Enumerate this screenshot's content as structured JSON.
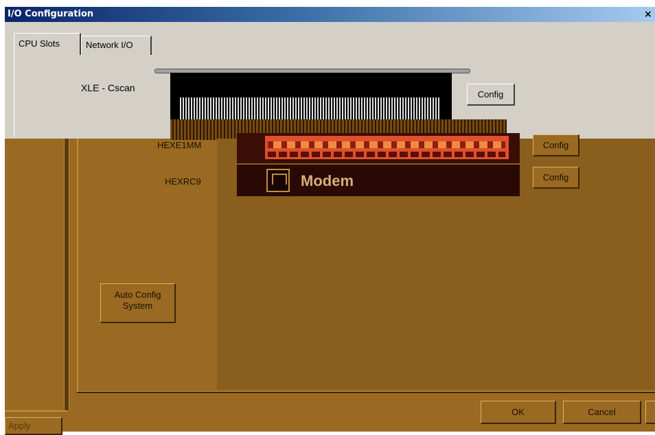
{
  "window": {
    "title": "I/O Configuration",
    "close_glyph": "×"
  },
  "tabs": [
    {
      "label": "CPU Slots",
      "active": true
    },
    {
      "label": "Network I/O",
      "active": false
    }
  ],
  "cpu": {
    "label": "XLE - Cscan",
    "config_label": "Config"
  },
  "slots": [
    {
      "label": "HEXE1MM",
      "config_label": "Config"
    },
    {
      "label": "HEXRC9",
      "module_text": "Modem",
      "config_label": "Config"
    }
  ],
  "buttons": {
    "auto_config_line1": "Auto Config",
    "auto_config_line2": "System",
    "ok": "OK",
    "cancel": "Cancel",
    "apply": "Apply"
  },
  "colors": {
    "title_bar": "#0a246a",
    "panel_gray": "#d4d0c8",
    "rack_brown": "#9a6a22",
    "io_orange": "#e0502a"
  },
  "icons": {
    "modem": "phone-jack-icon",
    "close": "close-icon"
  }
}
